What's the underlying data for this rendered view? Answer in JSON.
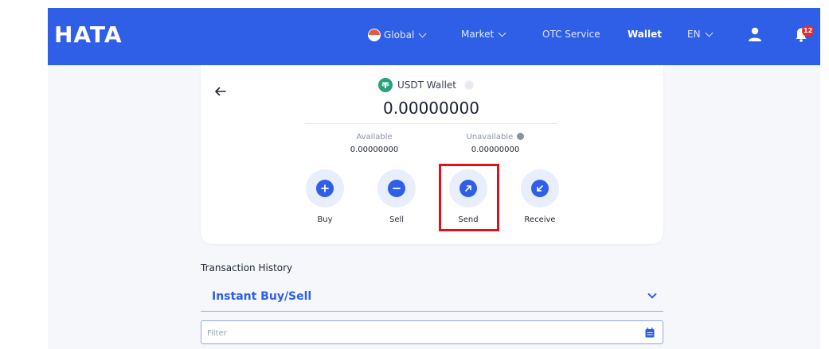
{
  "navbar": {
    "logo": "HATA",
    "items": [
      {
        "label": "Global",
        "icon": "globe-icon",
        "dropdown": true
      },
      {
        "label": "Market",
        "dropdown": true
      },
      {
        "label": "OTC Service",
        "dropdown": false
      },
      {
        "label": "Wallet",
        "active": true
      },
      {
        "label": "EN",
        "dropdown": true
      }
    ],
    "notification_count": "12",
    "colors": {
      "bar": "#2f5fe6",
      "badge": "#e52c2c"
    }
  },
  "wallet": {
    "name": "USDT Wallet",
    "balance": "0.00000000",
    "available_label": "Available",
    "available_value": "0.00000000",
    "unavailable_label": "Unavailable",
    "unavailable_value": "0.00000000",
    "icons": {
      "coin": "usdt-icon",
      "visibility": "eye-icon",
      "back": "back-arrow-icon"
    }
  },
  "actions": [
    {
      "label": "Buy",
      "icon": "plus-icon"
    },
    {
      "label": "Sell",
      "icon": "minus-icon"
    },
    {
      "label": "Send",
      "icon": "arrow-up-right-icon",
      "highlighted": true
    },
    {
      "label": "Receive",
      "icon": "arrow-down-left-icon"
    }
  ],
  "transactions": {
    "title": "Transaction History",
    "selected_type": "Instant Buy/Sell",
    "filter_placeholder": "Filter",
    "filter_value": ""
  }
}
